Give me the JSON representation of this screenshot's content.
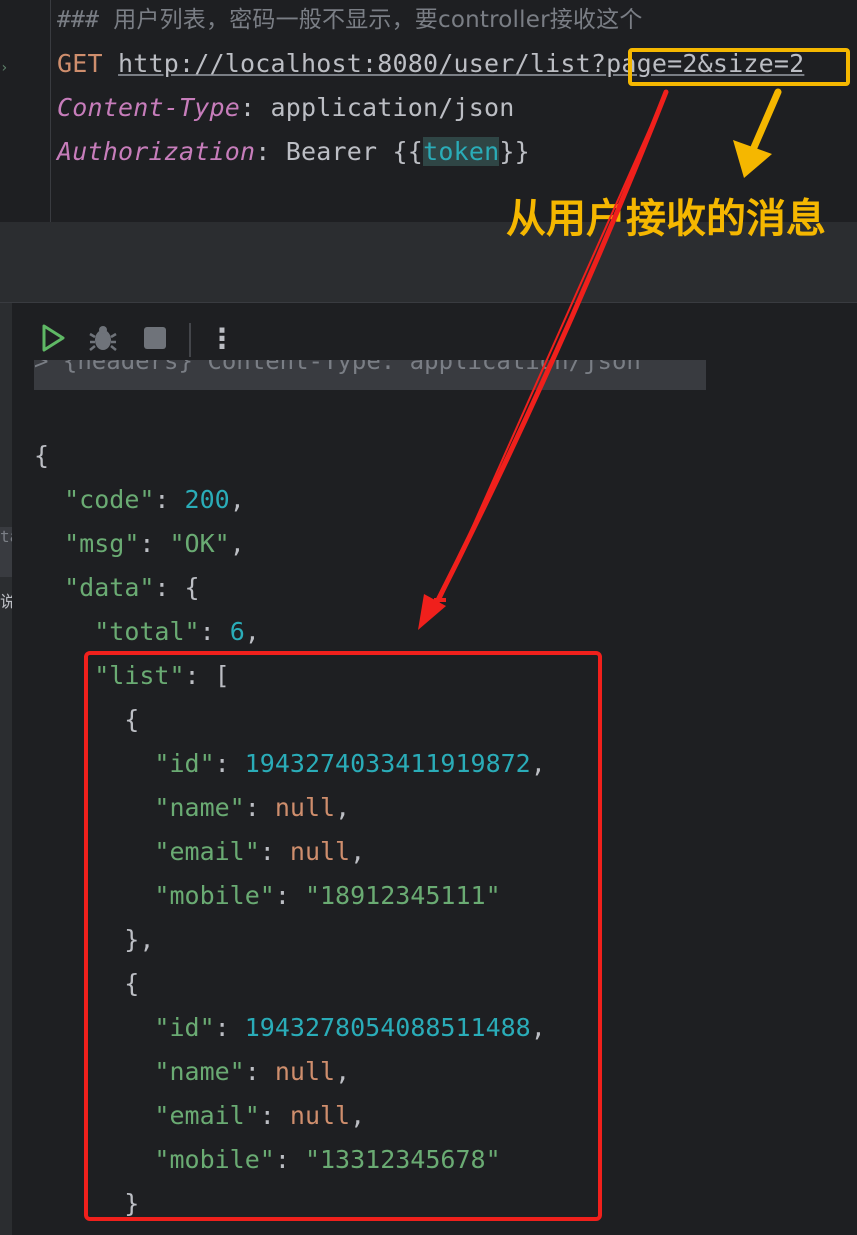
{
  "request": {
    "comment_hash": "### ",
    "comment_text": "用户列表，密码一般不显示，要controller接收这个",
    "method": "GET",
    "url_base": "http://localhost:8080/user/list?",
    "url_query": "page=2&size=2",
    "header1_key": "Content-Type",
    "header1_sep": ": ",
    "header1_val": "application/json",
    "header2_key": "Authorization",
    "header2_sep": ": ",
    "header2_pre": "Bearer {{",
    "header2_var": "token",
    "header2_post": "}}"
  },
  "annotation": {
    "text": "从用户接收的消息",
    "color": "#f5b700",
    "box_color": "#f5b700",
    "arrow_color": "#f0201c"
  },
  "toolbar": {
    "run_icon": "play-icon",
    "debug_icon": "bug-icon",
    "stop_icon": "stop-icon",
    "more_icon": "more-vertical-icon",
    "more_glyph": "⋮"
  },
  "response": {
    "headers_line": "> {headers} Content-Type: application/json",
    "side_tag": "ta",
    "side_tag2": "说",
    "open_brace": "{",
    "code_key": "\"code\"",
    "code_val": "200",
    "msg_key": "\"msg\"",
    "msg_val": "\"OK\"",
    "data_key": "\"data\"",
    "total_key": "\"total\"",
    "total_val": "6",
    "list_key": "\"list\"",
    "items": [
      {
        "id_key": "\"id\"",
        "id": "1943274033411919872",
        "name_key": "\"name\"",
        "name": "null",
        "email_key": "\"email\"",
        "email": "null",
        "mobile_key": "\"mobile\"",
        "mobile": "\"18912345111\""
      },
      {
        "id_key": "\"id\"",
        "id": "1943278054088511488",
        "name_key": "\"name\"",
        "name": "null",
        "email_key": "\"email\"",
        "email": "null",
        "mobile_key": "\"mobile\"",
        "mobile": "\"13312345678\""
      }
    ]
  }
}
